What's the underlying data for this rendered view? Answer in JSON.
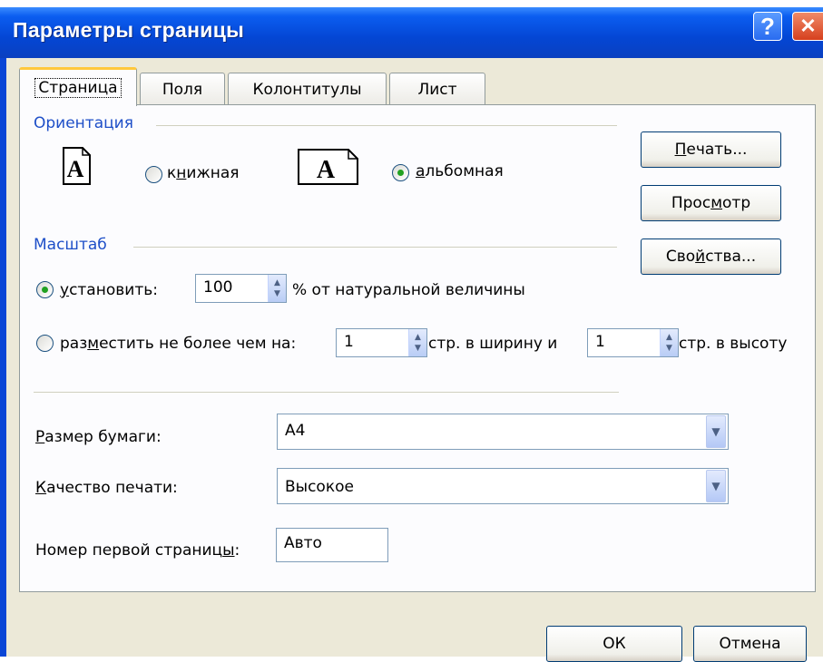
{
  "window": {
    "title": "Параметры страницы",
    "help_glyph": "?",
    "close_glyph": "✕"
  },
  "tabs": [
    {
      "label": "Страница",
      "active": true
    },
    {
      "label": "Поля",
      "active": false
    },
    {
      "label": "Колонтитулы",
      "active": false
    },
    {
      "label": "Лист",
      "active": false
    }
  ],
  "orientation": {
    "group_label": "Ориентация",
    "portrait_pre": "к",
    "portrait_mnemonic": "н",
    "portrait_post": "ижная",
    "landscape_pre": "",
    "landscape_mnemonic": "а",
    "landscape_post": "льбомная",
    "selected": "landscape",
    "icon_letter": "A"
  },
  "scale": {
    "group_label": "Масштаб",
    "set_pre": "",
    "set_mnemonic": "у",
    "set_post": "становить:",
    "set_value": "100",
    "set_suffix": "% от натуральной величины",
    "fit_pre": "раз",
    "fit_mnemonic": "м",
    "fit_post": "естить не более чем на:",
    "fit_wide_value": "1",
    "fit_wide_suffix": "стр. в ширину и",
    "fit_tall_value": "1",
    "fit_tall_suffix": "стр. в высоту",
    "selected": "set"
  },
  "paper": {
    "size_label_mnemonic": "Р",
    "size_label_post": "азмер бумаги:",
    "size_value": "A4",
    "quality_label_mnemonic": "К",
    "quality_label_post": "ачество печати:",
    "quality_value": "Высокое",
    "first_page_pre": "Номер первой страниц",
    "first_page_mnemonic": "ы",
    "first_page_post": ":",
    "first_page_value": "Авто"
  },
  "side_buttons": {
    "print_mnemonic": "П",
    "print_post": "ечать...",
    "preview_pre": "Прос",
    "preview_mnemonic": "м",
    "preview_post": "отр",
    "props_pre": "Сво",
    "props_mnemonic": "й",
    "props_post": "ства..."
  },
  "footer": {
    "ok": "ОК",
    "cancel": "Отмена"
  },
  "colors": {
    "titlebar": "#0446d4",
    "group_label": "#1e4fc8",
    "radio_dot": "#21a121",
    "active_tab_accent": "#ffc83c"
  }
}
